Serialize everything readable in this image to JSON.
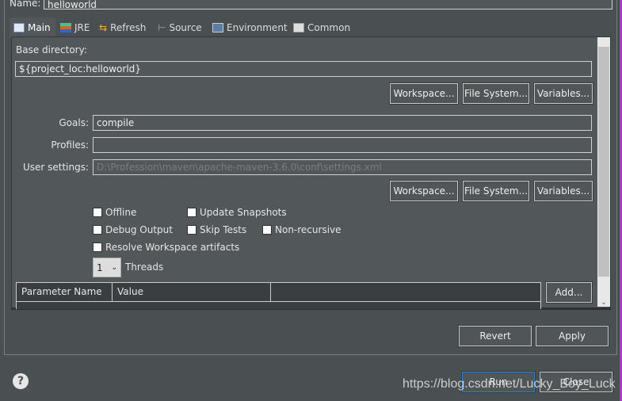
{
  "name_label": "Name:",
  "name_value": "helloworld",
  "tabs": [
    {
      "label": "Main",
      "icon": "main-tab-icon"
    },
    {
      "label": "JRE",
      "icon": "jre-icon"
    },
    {
      "label": "Refresh",
      "icon": "refresh-icon"
    },
    {
      "label": "Source",
      "icon": "source-icon"
    },
    {
      "label": "Environment",
      "icon": "environment-icon"
    },
    {
      "label": "Common",
      "icon": "common-icon"
    }
  ],
  "main": {
    "base_dir_label": "Base directory:",
    "base_dir_value": "${project_loc:helloworld}",
    "workspace_btn": "Workspace...",
    "filesystem_btn": "File System...",
    "variables_btn": "Variables...",
    "goals_label": "Goals:",
    "goals_value": "compile",
    "profiles_label": "Profiles:",
    "profiles_value": "",
    "user_settings_label": "User settings:",
    "user_settings_value": "D:\\Profession\\maven\\apache-maven-3.6.0\\conf\\settings.xml",
    "checkboxes": {
      "offline": "Offline",
      "update_snapshots": "Update Snapshots",
      "debug_output": "Debug Output",
      "skip_tests": "Skip Tests",
      "non_recursive": "Non-recursive",
      "resolve_workspace": "Resolve Workspace artifacts"
    },
    "threads_value": "1",
    "threads_label": "Threads",
    "table_headers": [
      "Parameter Name",
      "Value"
    ],
    "add_btn": "Add..."
  },
  "revert_btn": "Revert",
  "apply_btn": "Apply",
  "run_btn": "Run",
  "close_btn": "Close",
  "help_icon": "?",
  "watermark": "https://blog.csdn.net/Lucky_Boy_Luck"
}
